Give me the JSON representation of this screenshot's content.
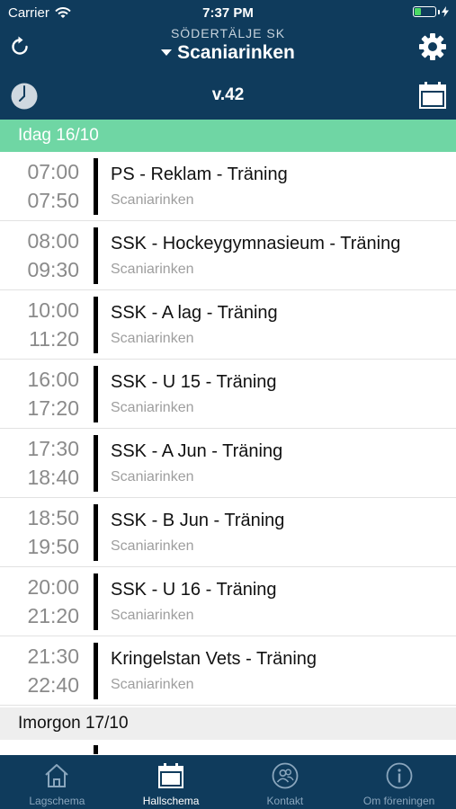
{
  "status": {
    "carrier": "Carrier",
    "time": "7:37 PM"
  },
  "header": {
    "club": "SÖDERTÄLJE SK",
    "arena": "Scaniarinken",
    "week": "v.42"
  },
  "colors": {
    "navy": "#0f3b5c",
    "today_green": "#6fd6a4",
    "battery": "#4cd964"
  },
  "days": [
    {
      "label": "Idag 16/10",
      "events": [
        {
          "start": "07:00",
          "end": "07:50",
          "title": "PS - Reklam - Träning",
          "location": "Scaniarinken"
        },
        {
          "start": "08:00",
          "end": "09:30",
          "title": "SSK - Hockeygymnasieum - Träning",
          "location": "Scaniarinken"
        },
        {
          "start": "10:00",
          "end": "11:20",
          "title": "SSK - A lag - Träning",
          "location": "Scaniarinken"
        },
        {
          "start": "16:00",
          "end": "17:20",
          "title": "SSK - U 15 - Träning",
          "location": "Scaniarinken"
        },
        {
          "start": "17:30",
          "end": "18:40",
          "title": "SSK - A Jun - Träning",
          "location": "Scaniarinken"
        },
        {
          "start": "18:50",
          "end": "19:50",
          "title": "SSK - B Jun - Träning",
          "location": "Scaniarinken"
        },
        {
          "start": "20:00",
          "end": "21:20",
          "title": "SSK - U 16 - Träning",
          "location": "Scaniarinken"
        },
        {
          "start": "21:30",
          "end": "22:40",
          "title": "Kringelstan Vets - Träning",
          "location": "Scaniarinken"
        }
      ]
    },
    {
      "label": "Imorgon 17/10"
    }
  ],
  "tabs": [
    {
      "label": "Lagschema",
      "icon": "house-icon"
    },
    {
      "label": "Hallschema",
      "icon": "calendar-icon",
      "active": true
    },
    {
      "label": "Kontakt",
      "icon": "contacts-icon"
    },
    {
      "label": "Om föreningen",
      "icon": "info-icon"
    }
  ]
}
